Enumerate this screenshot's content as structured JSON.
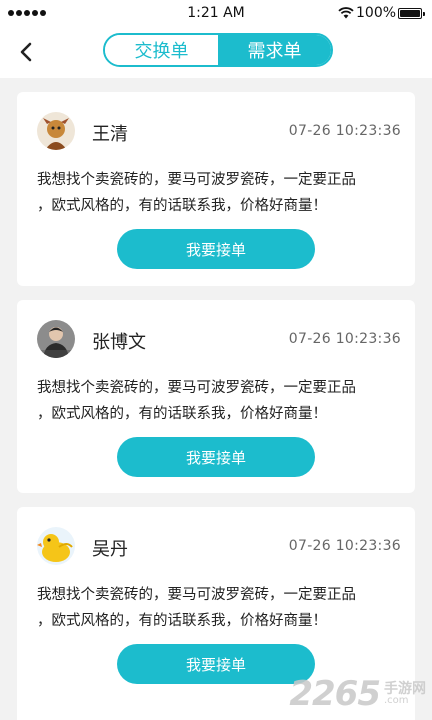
{
  "status_bar": {
    "time": "1:21 AM",
    "battery": "100%",
    "battery_level": 1.0,
    "signal_dots": 5
  },
  "nav": {
    "tabs": [
      {
        "label": "交换单",
        "active": false
      },
      {
        "label": "需求单",
        "active": true
      }
    ],
    "accent_color": "#1cbccd"
  },
  "orders": [
    {
      "name": "王清",
      "datetime": "07-26   10:23:36",
      "content_lines": [
        "我想找个卖瓷砖的，要马可波罗瓷砖，一定要正品",
        "，欧式风格的，有的话联系我，价格好商量！"
      ],
      "button_label": "我要接单",
      "avatar_icon": "cartoon-figure-avatar"
    },
    {
      "name": "张博文",
      "datetime": "07-26   10:23:36",
      "content_lines": [
        "我想找个卖瓷砖的，要马可波罗瓷砖，一定要正品",
        "，欧式风格的，有的话联系我，价格好商量！"
      ],
      "button_label": "我要接单",
      "avatar_icon": "person-photo-avatar"
    },
    {
      "name": "吴丹",
      "datetime": "07-26   10:23:36",
      "content_lines": [
        "我想找个卖瓷砖的，要马可波罗瓷砖，一定要正品",
        "，欧式风格的，有的话联系我，价格好商量！"
      ],
      "button_label": "我要接单",
      "avatar_icon": "yellow-duck-avatar"
    }
  ],
  "watermark": {
    "big": "2265",
    "top": "手游网",
    "bottom": ".com"
  }
}
